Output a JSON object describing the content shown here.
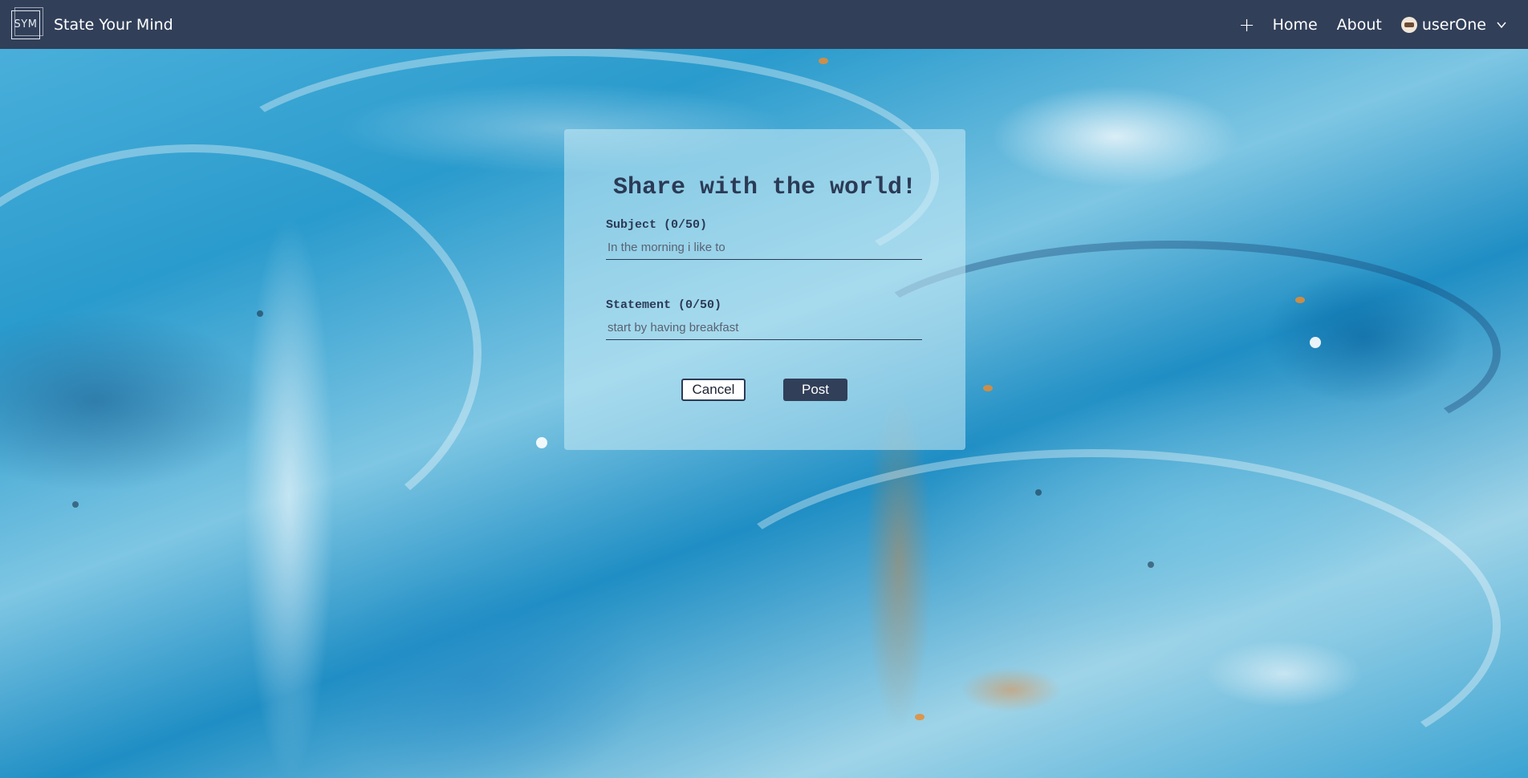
{
  "app": {
    "logo_text": "SYM",
    "brand_name": "State Your Mind"
  },
  "nav": {
    "add_icon": "plus-icon",
    "links": [
      "Home",
      "About"
    ],
    "user_name": "userOne",
    "user_menu_icon": "chevron-down-icon"
  },
  "form": {
    "title": "Share with the world!",
    "subject_label": "Subject (0/50)",
    "subject_placeholder": "In the morning i like to",
    "statement_label": "Statement (0/50)",
    "statement_placeholder": "start by having breakfast",
    "cancel_label": "Cancel",
    "post_label": "Post"
  },
  "colors": {
    "navbar": "#313f59",
    "accent": "#2b3a55",
    "card": "rgba(200,235,245,0.55)"
  }
}
